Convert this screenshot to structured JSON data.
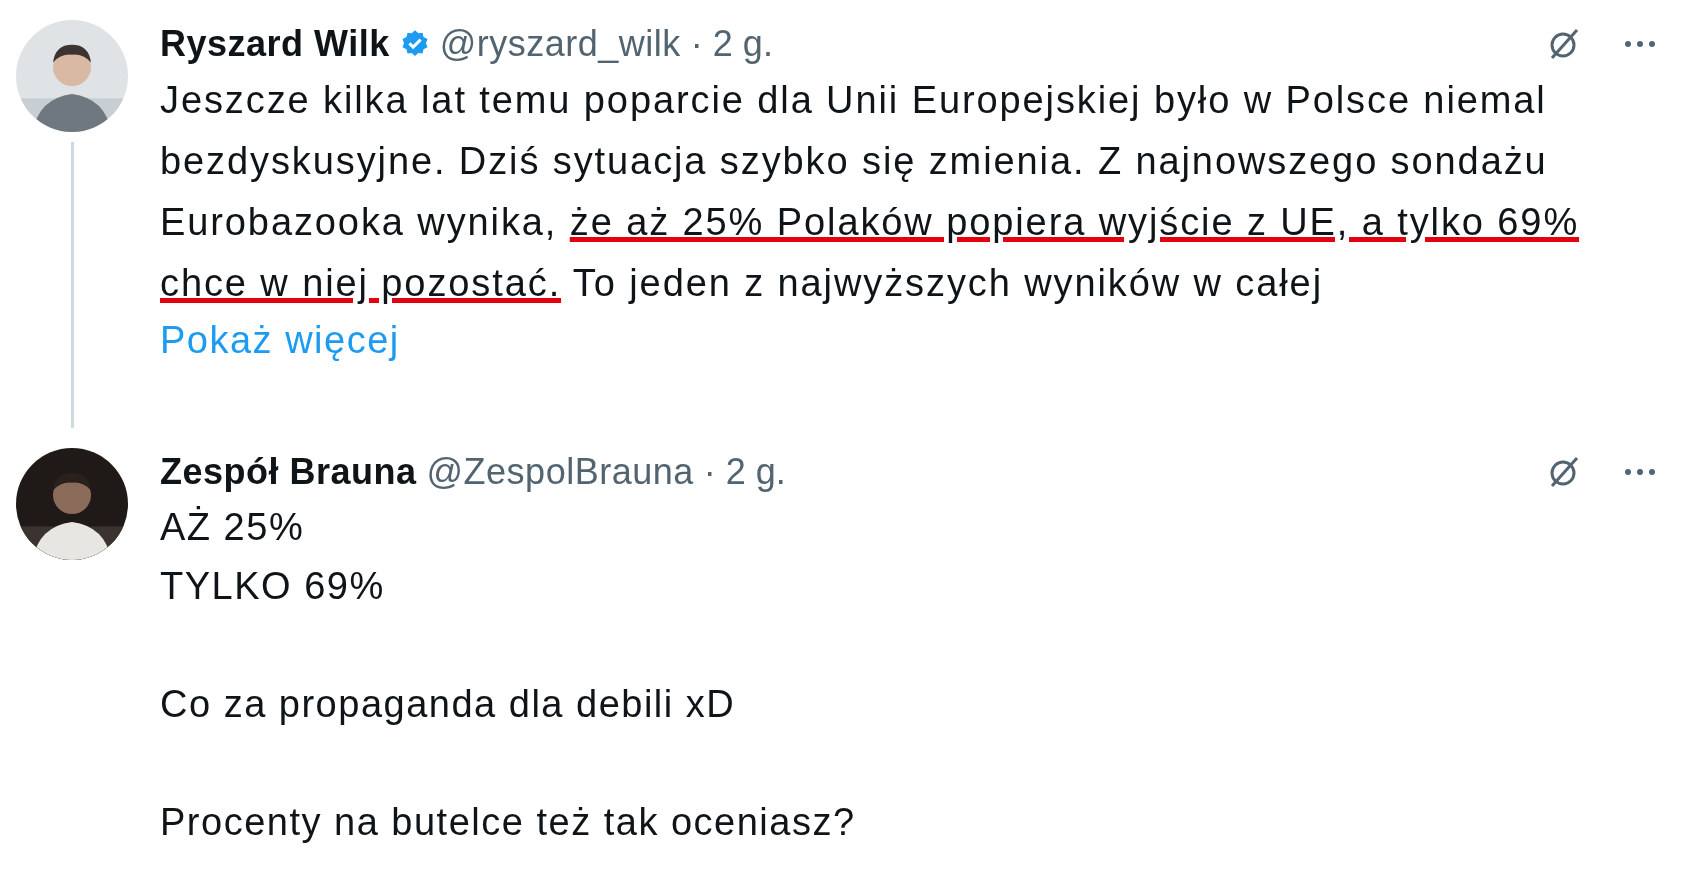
{
  "tweets": [
    {
      "name": "Ryszard Wilk",
      "verified": true,
      "handle": "@ryszard_wilk",
      "time": "· 2 g.",
      "thread_line": true,
      "body": [
        {
          "text": "Jeszcze kilka lat temu poparcie dla Unii Europejskiej było w Polsce niemal bezdyskusyjne. Dziś sytuacja szybko się zmienia. Z najnowszego sondażu Eurobazooka wynika, ",
          "underlined": false
        },
        {
          "text": "że aż 25% Polaków popiera wyjście z UE, a tylko 69% chce w niej pozostać.",
          "underlined": true
        },
        {
          "text": " To jeden z najwyższych wyników w całej",
          "underlined": false
        }
      ],
      "show_more": "Pokaż więcej"
    },
    {
      "name": "Zespół Brauna",
      "handle": "@ZespolBrauna",
      "time": "· 2 g.",
      "paragraphs": [
        [
          "AŻ 25%",
          "TYLKO 69%"
        ],
        [
          "Co za propaganda dla debili xD"
        ],
        [
          "Procenty na butelce też tak oceniasz?"
        ]
      ]
    }
  ]
}
